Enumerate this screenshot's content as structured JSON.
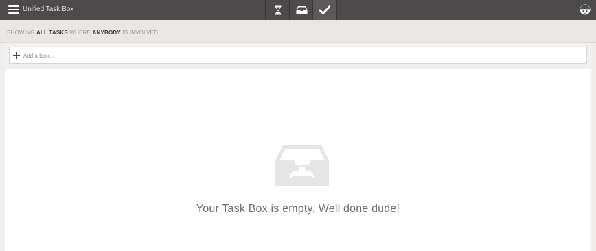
{
  "header": {
    "menu_icon": "hamburger-menu-icon",
    "title": "Unified Task Box",
    "nav": [
      {
        "icon": "hourglass-icon",
        "label": "Waiting"
      },
      {
        "icon": "inbox-icon",
        "label": "Inbox"
      },
      {
        "icon": "checkmark-icon",
        "label": "Completed"
      }
    ],
    "avatar_icon": "user-avatar-icon"
  },
  "filter": {
    "prefix": "SHOWING ",
    "scope": "ALL TASKS",
    "middle": " WHERE ",
    "who": "ANYBODY",
    "suffix": " IS INVOLVED"
  },
  "add_task": {
    "icon": "plus-icon",
    "placeholder": "Add a task...",
    "value": ""
  },
  "empty_state": {
    "icon": "mustache-inbox-icon",
    "message": "Your Task Box is empty. Well done dude!"
  },
  "colors": {
    "topbar": "#4c4a4b",
    "filterbar": "#e9e7e4",
    "empty_icon": "#e6e4e4",
    "message_text": "#6f6d6d"
  }
}
